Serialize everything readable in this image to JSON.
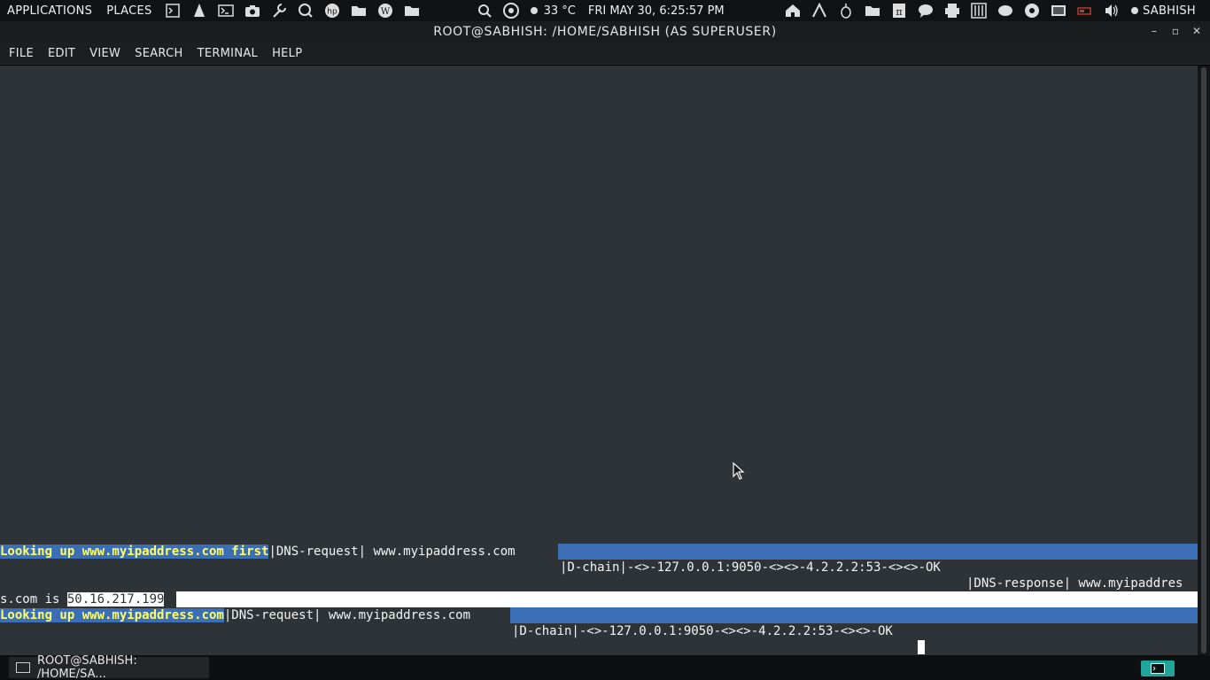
{
  "top_panel": {
    "applications_label": "APPLICATIONS",
    "places_label": "PLACES",
    "launcher_icons": [
      "terminal-icon",
      "text-editor-icon",
      "console-icon",
      "camera-icon",
      "wrench-icon",
      "search-app-icon",
      "hp-icon",
      "folder-icon",
      "wordpress-icon",
      "folder-icon"
    ],
    "temperature": "33 °C",
    "clock": "FRI MAY 30,  6:25:57 PM",
    "tray_icons": [
      "home-icon",
      "arc-icon",
      "onion-icon",
      "folder-icon",
      "pi-icon",
      "chat-icon",
      "printer-icon",
      "mixer-icon",
      "monitor-icon",
      "chrome-icon",
      "media-icon",
      "battery-icon",
      "volume-icon"
    ],
    "user_label": "SABHISH"
  },
  "window": {
    "title": "ROOT@SABHISH: /HOME/SABHISH (AS SUPERUSER)",
    "controls": {
      "minimize": "–",
      "maximize": "▫",
      "close": "✕"
    }
  },
  "menubar": {
    "items": [
      "FILE",
      "EDIT",
      "VIEW",
      "SEARCH",
      "TERMINAL",
      "HELP"
    ]
  },
  "terminal": {
    "lines": [
      {
        "hl": "Looking up www.myipaddress.com first",
        "rest": "|DNS-request| www.myipaddress.com"
      },
      {
        "rest": "|D-chain|-<>-127.0.0.1:9050-<><>-4.2.2.2:53-<><>-OK"
      },
      {
        "rest": "|DNS-response| www.myipaddres"
      },
      {
        "prefix": "s.com is ",
        "ip": "50.16.217.199"
      },
      {
        "hl": "Looking up www.myipaddress.com",
        "rest": "|DNS-request| www.myipaddress.com"
      },
      {
        "rest": "|D-chain|-<>-127.0.0.1:9050-<><>-4.2.2.2:53-<><>-OK"
      }
    ]
  },
  "taskbar": {
    "task_label": "ROOT@SABHISH: /HOME/SA..."
  },
  "colors": {
    "terminal_bg": "#2d3336",
    "highlight_blue": "#3b6eb5",
    "highlight_text": "#ffff66",
    "workspace_accent": "#1fa59a"
  }
}
